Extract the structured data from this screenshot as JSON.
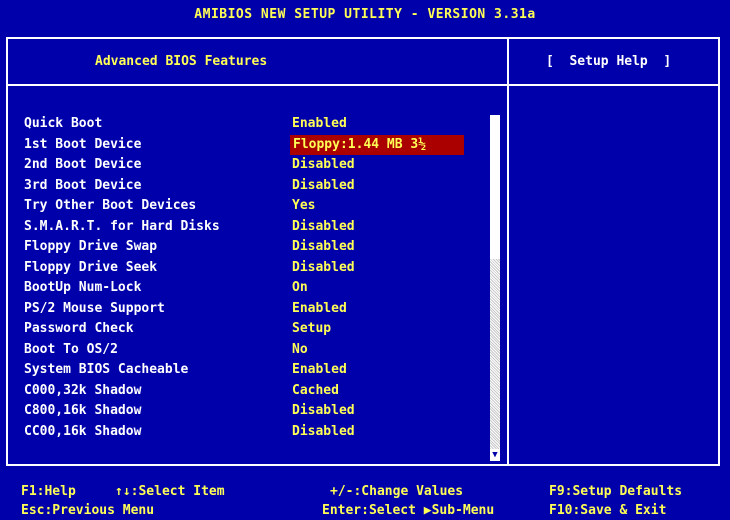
{
  "title": "AMIBIOS NEW SETUP UTILITY - VERSION 3.31a",
  "panel": {
    "title": "Advanced BIOS Features",
    "help_title": "[  Setup Help  ]"
  },
  "settings": [
    {
      "label": "Quick Boot",
      "value": "Enabled",
      "selected": false
    },
    {
      "label": "1st Boot Device",
      "value": "Floppy:1.44 MB 3½",
      "selected": true
    },
    {
      "label": "2nd Boot Device",
      "value": "Disabled",
      "selected": false
    },
    {
      "label": "3rd Boot Device",
      "value": "Disabled",
      "selected": false
    },
    {
      "label": "Try Other Boot Devices",
      "value": "Yes",
      "selected": false
    },
    {
      "label": "S.M.A.R.T. for Hard Disks",
      "value": "Disabled",
      "selected": false
    },
    {
      "label": "Floppy Drive Swap",
      "value": "Disabled",
      "selected": false
    },
    {
      "label": "Floppy Drive Seek",
      "value": "Disabled",
      "selected": false
    },
    {
      "label": "BootUp Num-Lock",
      "value": "On",
      "selected": false
    },
    {
      "label": "PS/2 Mouse Support",
      "value": "Enabled",
      "selected": false
    },
    {
      "label": "Password Check",
      "value": "Setup",
      "selected": false
    },
    {
      "label": "Boot To OS/2",
      "value": "No",
      "selected": false
    },
    {
      "label": "System BIOS Cacheable",
      "value": "Enabled",
      "selected": false
    },
    {
      "label": "C000,32k Shadow",
      "value": "Cached",
      "selected": false
    },
    {
      "label": "C800,16k Shadow",
      "value": "Disabled",
      "selected": false
    },
    {
      "label": "CC00,16k Shadow",
      "value": "Disabled",
      "selected": false
    }
  ],
  "scrollbar": {
    "down_arrow_icon": "down-triangle-icon",
    "down_arrow_glyph": "▼"
  },
  "footer": {
    "f1_help": "F1:Help",
    "select_item": "↑↓:Select Item",
    "change_values": "+/-:Change Values",
    "setup_defaults": "F9:Setup Defaults",
    "esc_menu": "Esc:Previous Menu",
    "enter_submenu": "Enter:Select ▶Sub-Menu",
    "save_exit": "F10:Save & Exit"
  },
  "colors": {
    "background": "#0000aa",
    "highlight_text": "#ffff55",
    "normal_text": "#ffffff",
    "selection_bg": "#aa0000"
  }
}
